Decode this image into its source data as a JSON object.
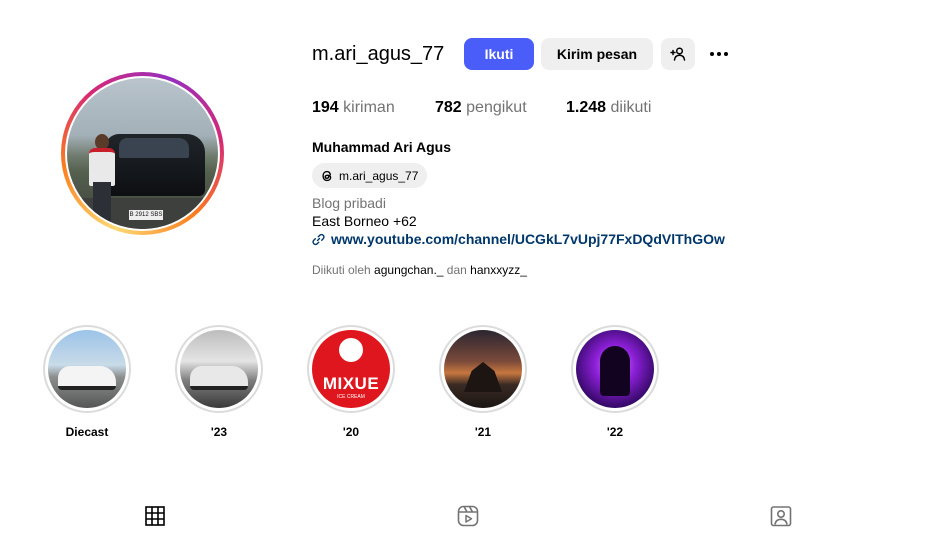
{
  "profile": {
    "username": "m.ari_agus_77",
    "full_name": "Muhammad Ari Agus",
    "avatar_plate_text": "B 2912 SBS"
  },
  "actions": {
    "follow_label": "Ikuti",
    "message_label": "Kirim pesan",
    "suggest_icon": "person-plus-icon",
    "more_icon": "ellipsis-icon"
  },
  "stats": {
    "posts_count": "194",
    "posts_label": "kiriman",
    "followers_count": "782",
    "followers_label": "pengikut",
    "following_count": "1.248",
    "following_label": "diikuti"
  },
  "threads": {
    "handle": "m.ari_agus_77",
    "icon": "threads-icon"
  },
  "bio": {
    "category": "Blog pribadi",
    "text": "East Borneo +62",
    "link": "www.youtube.com/channel/UCGkL7vUpj77FxDQdVlThGOw",
    "link_icon": "link-icon"
  },
  "followed_by": {
    "prefix": "Diikuti oleh",
    "account_1": "agungchan._",
    "joiner": "dan",
    "account_2": "hanxxyzz_"
  },
  "highlights": [
    {
      "label": "Diecast"
    },
    {
      "label": "'23"
    },
    {
      "label": "'20",
      "image_text": "MIXUE",
      "image_subtext": "ICE CREAM"
    },
    {
      "label": "'21"
    },
    {
      "label": "'22"
    }
  ],
  "tabs": [
    {
      "name": "posts",
      "icon": "grid-icon"
    },
    {
      "name": "reels",
      "icon": "reels-icon"
    },
    {
      "name": "tagged",
      "icon": "tagged-person-icon"
    }
  ],
  "colors": {
    "follow_button": "#4a5df9",
    "secondary_button": "#efefef",
    "muted_text": "#737373",
    "link_text": "#00376b",
    "story_ring_gradient": [
      "#feda75",
      "#fa7e1e",
      "#d62976",
      "#962fbf"
    ]
  }
}
